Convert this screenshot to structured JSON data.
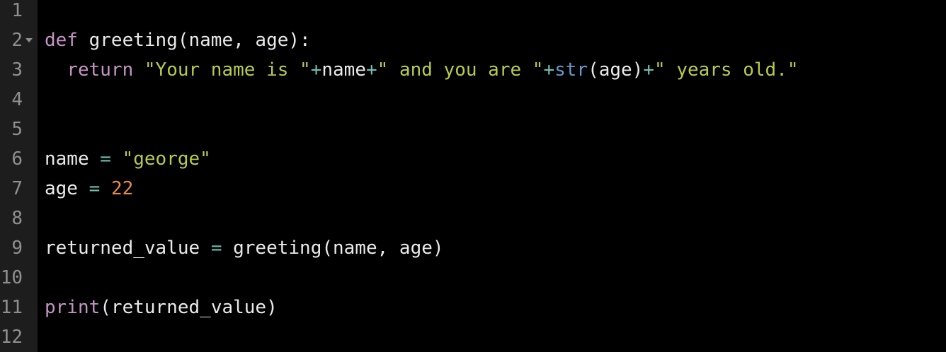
{
  "editor": {
    "line_numbers": [
      "1",
      "2",
      "3",
      "4",
      "5",
      "6",
      "7",
      "8",
      "9",
      "10",
      "11",
      "12"
    ],
    "lines": [
      {
        "tokens": []
      },
      {
        "tokens": [
          {
            "t": "def",
            "c": "kw"
          },
          {
            "t": " greeting(name, age):",
            "c": "plain"
          }
        ]
      },
      {
        "tokens": [
          {
            "t": "  ",
            "c": "plain"
          },
          {
            "t": "return",
            "c": "kw"
          },
          {
            "t": " ",
            "c": "plain"
          },
          {
            "t": "\"Your name is \"",
            "c": "str"
          },
          {
            "t": "+",
            "c": "op"
          },
          {
            "t": "name",
            "c": "plain"
          },
          {
            "t": "+",
            "c": "op"
          },
          {
            "t": "\" and you are \"",
            "c": "str"
          },
          {
            "t": "+",
            "c": "op"
          },
          {
            "t": "str",
            "c": "fn"
          },
          {
            "t": "(age)",
            "c": "plain"
          },
          {
            "t": "+",
            "c": "op"
          },
          {
            "t": "\" years old.\"",
            "c": "str"
          }
        ]
      },
      {
        "tokens": []
      },
      {
        "tokens": []
      },
      {
        "tokens": [
          {
            "t": "name ",
            "c": "plain"
          },
          {
            "t": "=",
            "c": "op"
          },
          {
            "t": " ",
            "c": "plain"
          },
          {
            "t": "\"george\"",
            "c": "str"
          }
        ]
      },
      {
        "tokens": [
          {
            "t": "age ",
            "c": "plain"
          },
          {
            "t": "=",
            "c": "op"
          },
          {
            "t": " ",
            "c": "plain"
          },
          {
            "t": "22",
            "c": "num"
          }
        ]
      },
      {
        "tokens": []
      },
      {
        "tokens": [
          {
            "t": "returned_value ",
            "c": "plain"
          },
          {
            "t": "=",
            "c": "op"
          },
          {
            "t": " greeting(name, age)",
            "c": "plain"
          }
        ]
      },
      {
        "tokens": []
      },
      {
        "tokens": [
          {
            "t": "print",
            "c": "kw"
          },
          {
            "t": "(returned_value)",
            "c": "plain"
          }
        ]
      },
      {
        "tokens": []
      }
    ],
    "fold_marker_lines": [
      "2"
    ],
    "colors": {
      "background": "#000000",
      "gutter": "#1d1d1d",
      "line_number": "#8f8f8f",
      "keyword": "#c594c5",
      "builtin": "#6699cc",
      "string": "#b9ca4a",
      "operator": "#70c0b1",
      "number": "#e78c45",
      "text": "#eaeaea"
    }
  }
}
